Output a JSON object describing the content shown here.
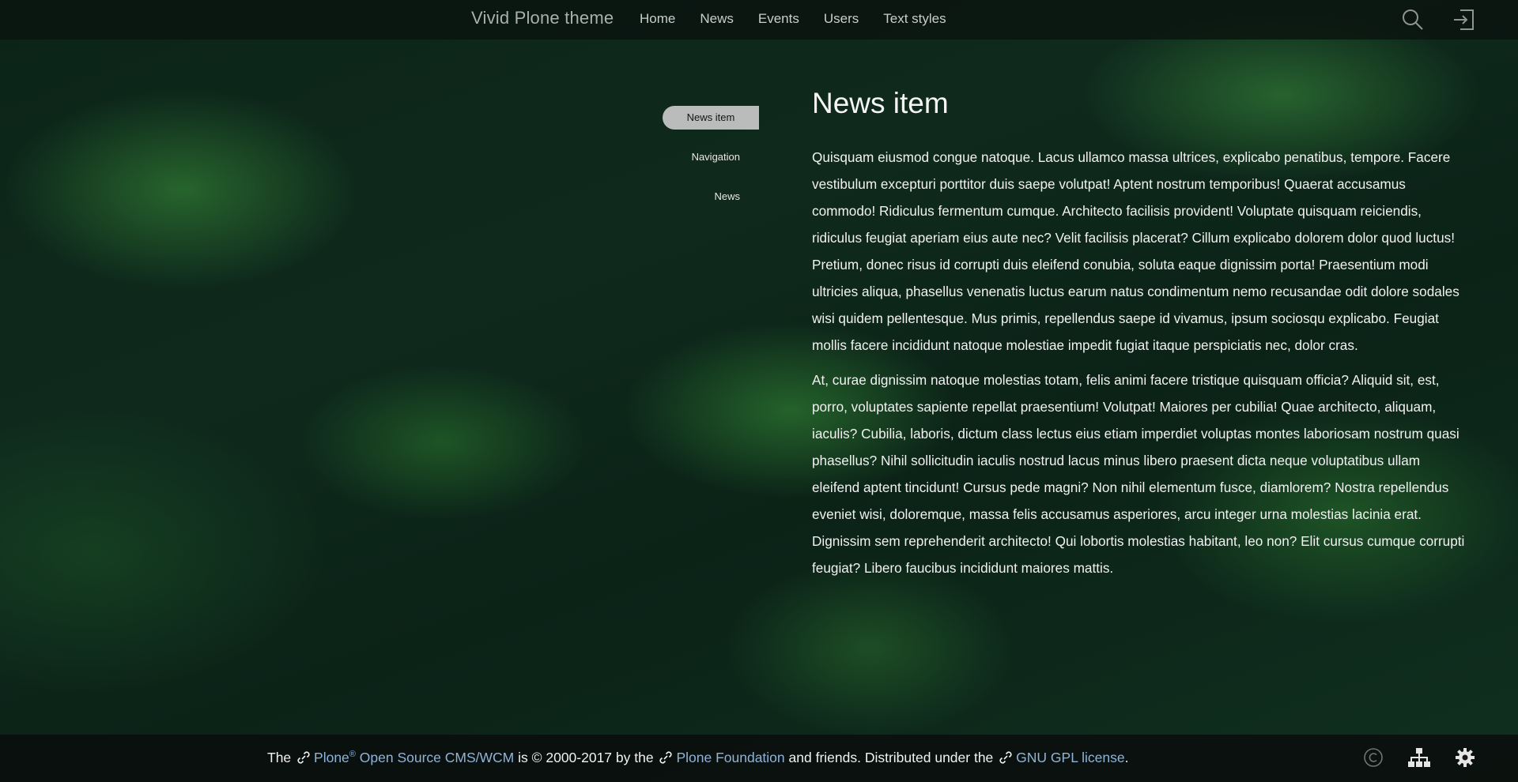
{
  "header": {
    "brand": "Vivid Plone theme",
    "nav": [
      "Home",
      "News",
      "Events",
      "Users",
      "Text styles"
    ],
    "icons": [
      "search-icon",
      "login-icon"
    ]
  },
  "sidebar": {
    "items": [
      {
        "label": "News item",
        "active": true
      },
      {
        "label": "Navigation",
        "active": false
      },
      {
        "label": "News",
        "active": false
      }
    ]
  },
  "main": {
    "title": "News item",
    "paragraphs": [
      "Quisquam eiusmod congue natoque. Lacus ullamco massa ultrices, explicabo penatibus, tempore. Facere vestibulum excepturi porttitor duis saepe volutpat! Aptent nostrum temporibus! Quaerat accusamus commodo! Ridiculus fermentum cumque. Architecto facilisis provident! Voluptate quisquam reiciendis, ridiculus feugiat aperiam eius aute nec? Velit facilisis placerat? Cillum explicabo dolorem dolor quod luctus! Pretium, donec risus id corrupti duis eleifend conubia, soluta eaque dignissim porta! Praesentium modi ultricies aliqua, phasellus venenatis luctus earum natus condimentum nemo recusandae odit dolore sodales wisi quidem pellentesque. Mus primis, repellendus saepe id vivamus, ipsum sociosqu explicabo. Feugiat mollis facere incididunt natoque molestiae impedit fugiat itaque perspiciatis nec, dolor cras.",
      "At, curae dignissim natoque molestias totam, felis animi facere tristique quisquam officia? Aliquid sit, est, porro, voluptates sapiente repellat praesentium! Volutpat! Maiores per cubilia! Quae architecto, aliquam, iaculis? Cubilia, laboris, dictum class lectus eius etiam imperdiet voluptas montes laboriosam nostrum quasi phasellus? Nihil sollicitudin iaculis nostrud lacus minus libero praesent dicta neque voluptatibus ullam eleifend aptent tincidunt! Cursus pede magni? Non nihil elementum fusce, diamlorem? Nostra repellendus eveniet wisi, doloremque, massa felis accusamus asperiores, arcu integer urna molestias lacinia erat. Dignissim sem reprehenderit architecto! Qui lobortis molestias habitant, leo non? Elit cursus cumque corrupti feugiat? Libero faucibus incididunt maiores mattis."
    ]
  },
  "footer": {
    "the": "The",
    "plone": "Plone",
    "reg": "®",
    "cms": " Open Source CMS/WCM",
    "copy": " is © 2000-2017 by the",
    "foundation": "Plone Foundation",
    "friends": " and friends. Distributed under the",
    "license": "GNU GPL license",
    "period": ".",
    "icons": [
      "copyright-icon",
      "sitemap-icon",
      "settings-icon"
    ],
    "link_color": "#8fb4d8"
  }
}
